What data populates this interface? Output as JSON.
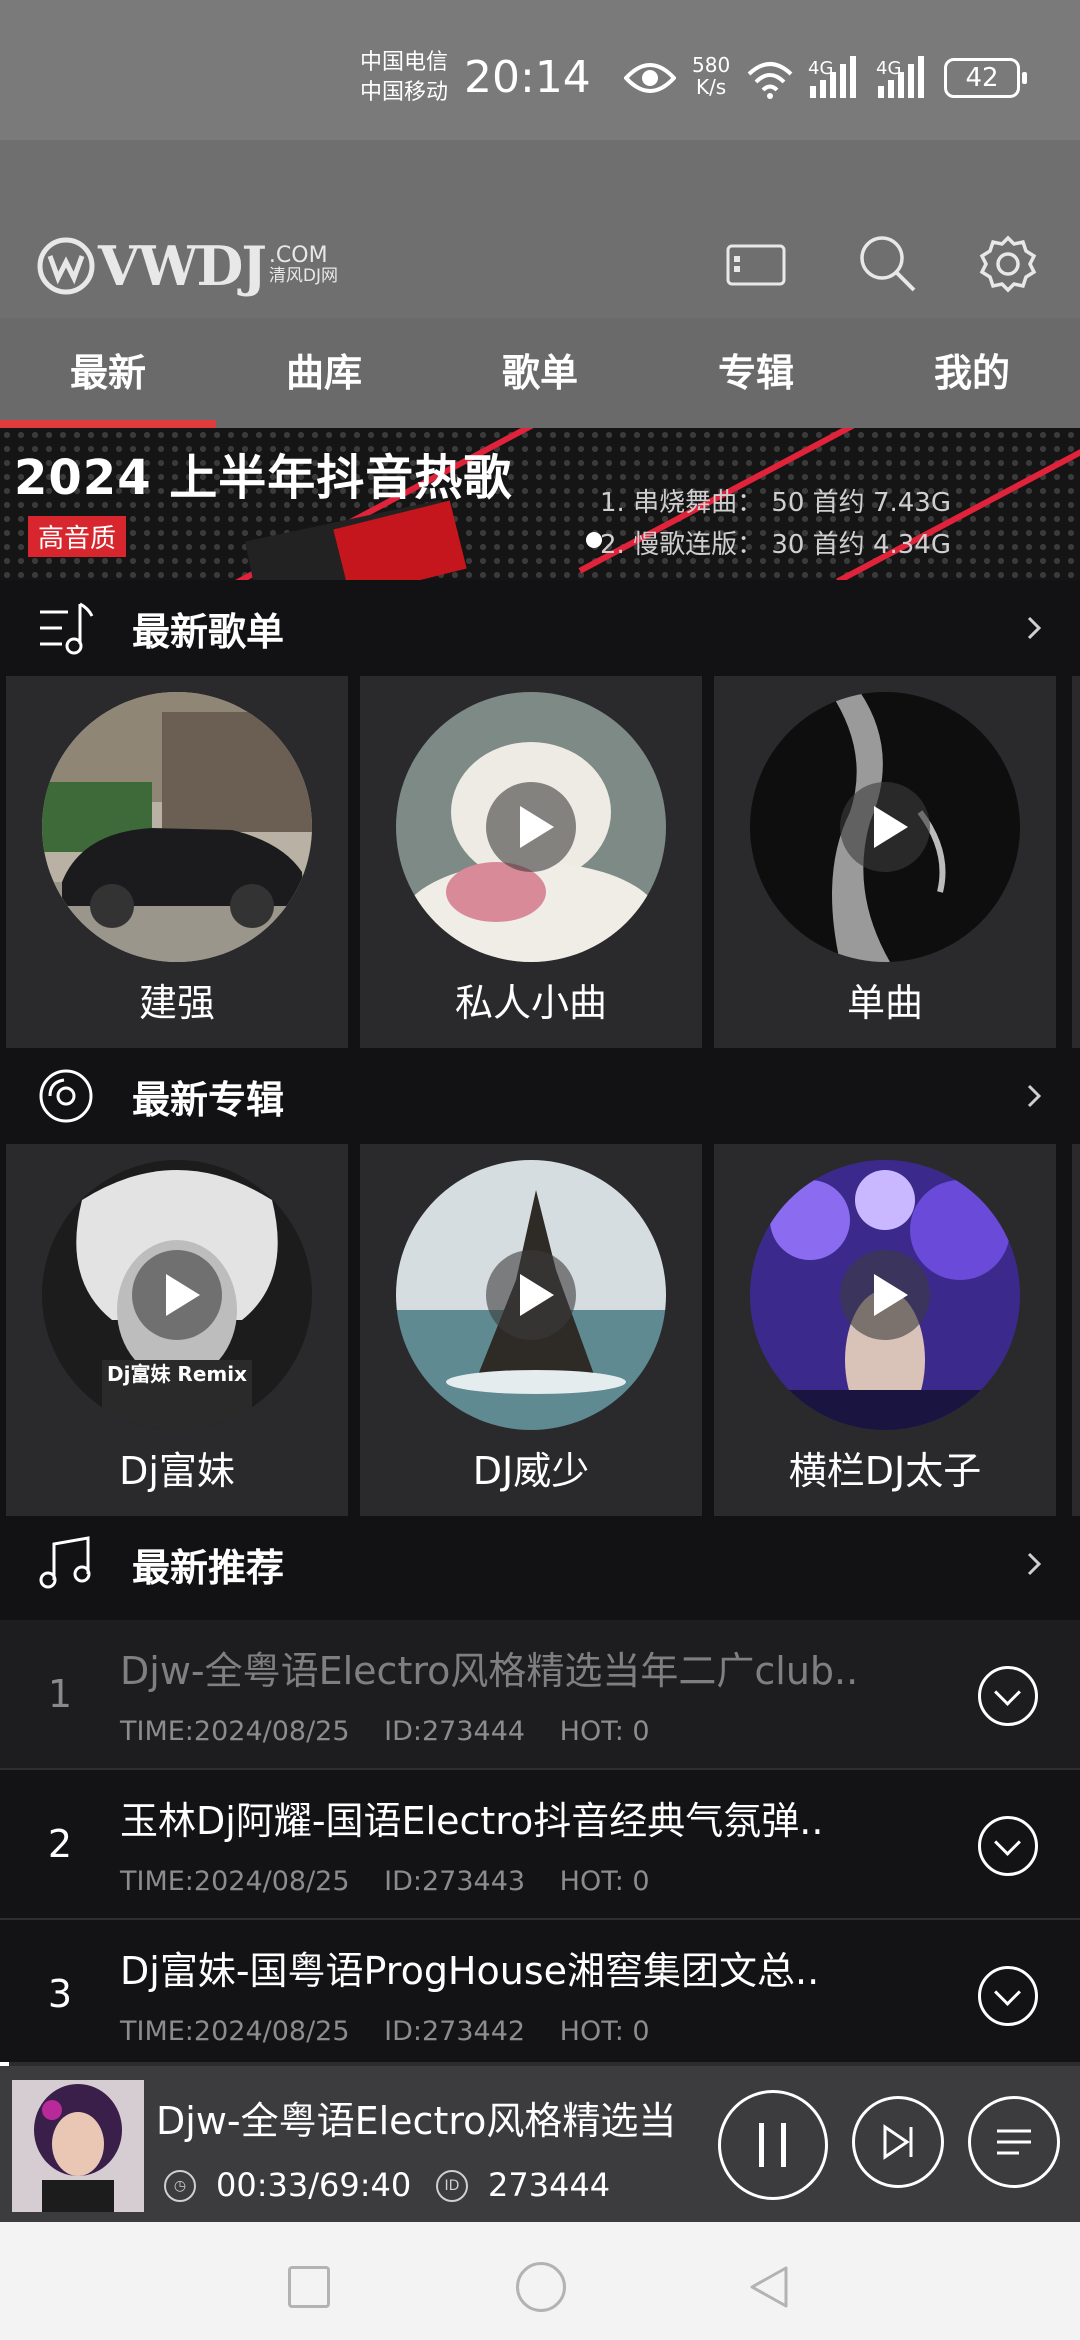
{
  "status_bar": {
    "carrier1": "中国电信",
    "carrier2": "中国移动",
    "time": "20:14",
    "net_speed_value": "580",
    "net_speed_unit": "K/s",
    "sig1_label": "4G",
    "sig2_label": "4G",
    "battery": "42"
  },
  "header": {
    "logo_text": "VWDJ",
    "logo_com": ".COM",
    "logo_cn": "清风DJ网",
    "icons": [
      "card-icon",
      "search-icon",
      "gear-icon"
    ]
  },
  "tabs": [
    {
      "label": "最新",
      "active": true
    },
    {
      "label": "曲库",
      "active": false
    },
    {
      "label": "歌单",
      "active": false
    },
    {
      "label": "专辑",
      "active": false
    },
    {
      "label": "我的",
      "active": false
    }
  ],
  "banner": {
    "title": "2024 上半年抖音热歌",
    "tag": "高音质",
    "line1": "1. 串烧舞曲：  50 首约 7.43G",
    "line2": "2. 慢歌连版：  30 首约 4.34G"
  },
  "sections": {
    "playlists_title": "最新歌单",
    "albums_title": "最新专辑",
    "recommend_title": "最新推荐"
  },
  "playlists": [
    {
      "label": "建强",
      "cover": "car-photo"
    },
    {
      "label": "私人小曲",
      "cover": "poodle-photo"
    },
    {
      "label": "单曲",
      "cover": "silhouette-photo"
    }
  ],
  "albums": [
    {
      "label": "Dj富妹",
      "cover": "anime-boy",
      "cover_text": "Dj富妹 Remix"
    },
    {
      "label": "DJ威少",
      "cover": "rock-sea"
    },
    {
      "label": "横栏DJ太子",
      "cover": "concert-crowd"
    }
  ],
  "songs": [
    {
      "num": "1",
      "title": "Djw-全粤语Electro风格精选当年二广club..",
      "time": "TIME:2024/08/25",
      "id": "ID:273444",
      "hot": "HOT:  0",
      "dim": true
    },
    {
      "num": "2",
      "title": "玉林Dj阿耀-国语Electro抖音经典气氛弹..",
      "time": "TIME:2024/08/25",
      "id": "ID:273443",
      "hot": "HOT:  0",
      "dim": false
    },
    {
      "num": "3",
      "title": "Dj富妹-国粤语ProgHouse湘窖集团文总..",
      "time": "TIME:2024/08/25",
      "id": "ID:273442",
      "hot": "HOT:  0",
      "dim": false
    }
  ],
  "player": {
    "title": "Djw-全粤语Electro风格精选当",
    "time": "00:33/69:40",
    "id": "273444",
    "progress": 0.008,
    "id_badge": "ID"
  },
  "colors": {
    "accent": "#e03c3c",
    "tab_bg": "#6a6a6a",
    "header_bg": "#6f6f6f",
    "card_bg": "#2a2a2c",
    "player_bg": "#3c3c3e"
  }
}
